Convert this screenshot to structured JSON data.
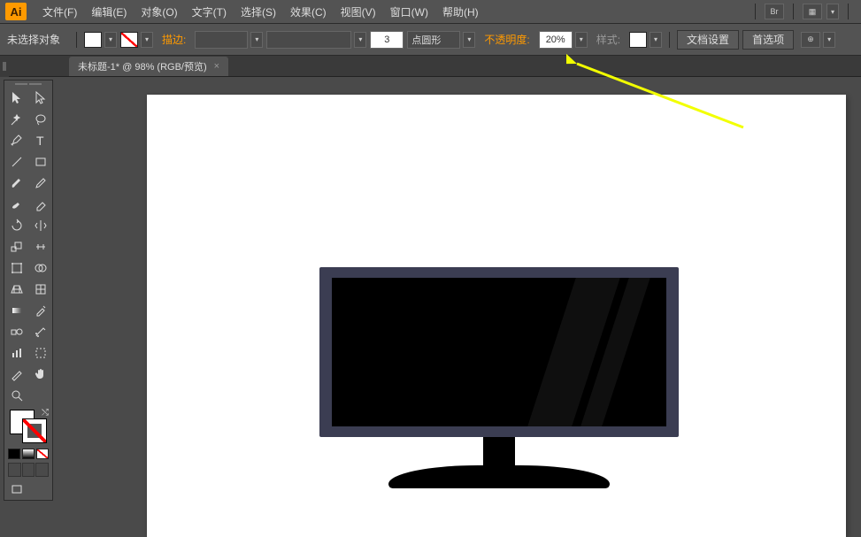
{
  "app": {
    "logo": "Ai"
  },
  "menu": {
    "file": "文件(F)",
    "edit": "编辑(E)",
    "object": "对象(O)",
    "text": "文字(T)",
    "select": "选择(S)",
    "effect": "效果(C)",
    "view": "视图(V)",
    "window": "窗口(W)",
    "help": "帮助(H)"
  },
  "controlbar": {
    "status": "未选择对象",
    "stroke_label": "描边:",
    "stroke_weight": "3",
    "stroke_style": "点圆形",
    "opacity_label": "不透明度:",
    "opacity_value": "20%",
    "style_label": "样式:",
    "doc_setup": "文档设置",
    "prefs": "首选项"
  },
  "tab": {
    "title": "未标题-1* @ 98% (RGB/预览)"
  },
  "icons": {
    "br": "Br",
    "layout": "▦"
  }
}
